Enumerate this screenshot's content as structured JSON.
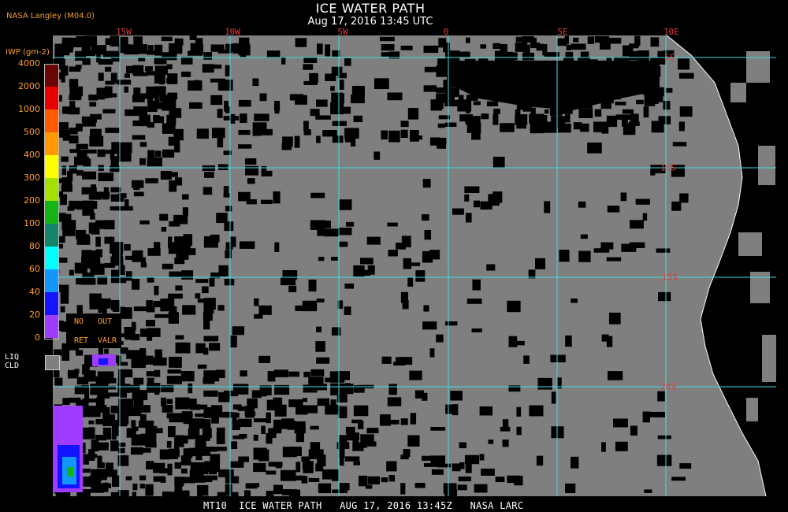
{
  "header": {
    "title": "ICE WATER PATH",
    "datetime": "Aug 17, 2016 13:45 UTC",
    "producer": "NASA Langley (M04.0)"
  },
  "legend": {
    "unit_label": "IWP (gm-2)",
    "ticks": [
      "4000",
      "2000",
      "1000",
      "500",
      "400",
      "300",
      "200",
      "100",
      "80",
      "60",
      "40",
      "20",
      "0"
    ],
    "colors": [
      "#6b0606",
      "#e80000",
      "#ff5a00",
      "#ff9a00",
      "#ffff00",
      "#a6e000",
      "#14b414",
      "#14876a",
      "#00ffff",
      "#1496ff",
      "#1414ff",
      "#9e3cff"
    ],
    "no_ret": [
      "NO",
      "RET"
    ],
    "out_valr": [
      "OUT",
      "VALR"
    ],
    "liq_cld": [
      "LIQ",
      "CLD"
    ],
    "liq_color": "#7f7f7f"
  },
  "graticule": {
    "lon_labels": [
      "15W",
      "10W",
      "5W",
      "0",
      "5E",
      "10E"
    ],
    "lat_labels": [
      "5S",
      "10S",
      "15S",
      "20S"
    ],
    "grid_color": "#40d8e0"
  },
  "footer": {
    "text": "MT10  ICE WATER PATH   AUG 17, 2016 13:45Z   NASA LARC"
  }
}
